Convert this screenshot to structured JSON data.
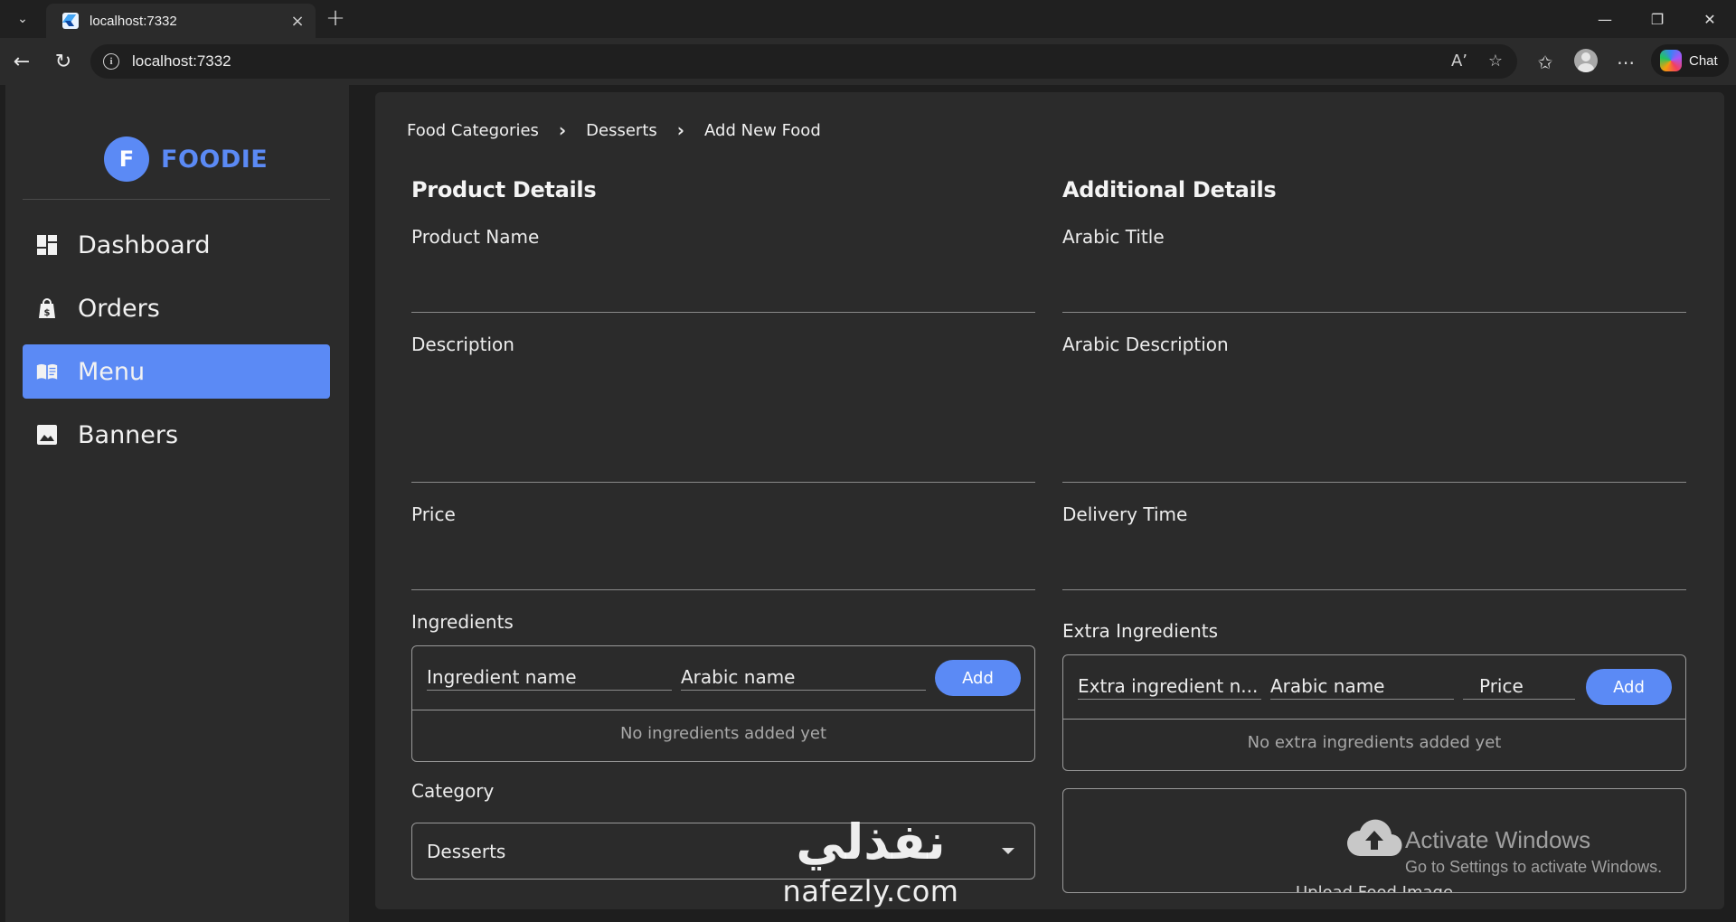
{
  "browser": {
    "tab_title": "localhost:7332",
    "url": "localhost:7332",
    "chat_label": "Chat"
  },
  "app": {
    "logo_letter": "F",
    "logo_text": "FOODIE",
    "accent_color": "#5b8af5"
  },
  "sidebar": {
    "items": [
      {
        "label": "Dashboard",
        "icon": "dashboard-icon",
        "active": false
      },
      {
        "label": "Orders",
        "icon": "shopping-bag-icon",
        "active": false
      },
      {
        "label": "Menu",
        "icon": "menu-book-icon",
        "active": true
      },
      {
        "label": "Banners",
        "icon": "image-icon",
        "active": false
      }
    ]
  },
  "breadcrumb": {
    "items": [
      "Food Categories",
      "Desserts",
      "Add New Food"
    ]
  },
  "product_details": {
    "title": "Product Details",
    "product_name_label": "Product Name",
    "description_label": "Description",
    "price_label": "Price",
    "ingredients": {
      "label": "Ingredients",
      "name_placeholder": "Ingredient name",
      "arabic_placeholder": "Arabic name",
      "add_label": "Add",
      "empty_text": "No ingredients added yet"
    },
    "category": {
      "label": "Category",
      "selected": "Desserts"
    }
  },
  "additional_details": {
    "title": "Additional Details",
    "arabic_title_label": "Arabic Title",
    "arabic_description_label": "Arabic Description",
    "delivery_time_label": "Delivery Time",
    "extra_ingredients": {
      "label": "Extra Ingredients",
      "name_placeholder": "Extra ingredient n...",
      "arabic_placeholder": "Arabic name",
      "price_placeholder": "Price",
      "add_label": "Add",
      "empty_text": "No extra ingredients added yet"
    },
    "upload": {
      "label": "Upload Food Image"
    }
  },
  "overlay": {
    "activate_title": "Activate Windows",
    "activate_sub": "Go to Settings to activate Windows.",
    "watermark_arabic": "نفذلي",
    "watermark_latin": "nafezly.com"
  }
}
